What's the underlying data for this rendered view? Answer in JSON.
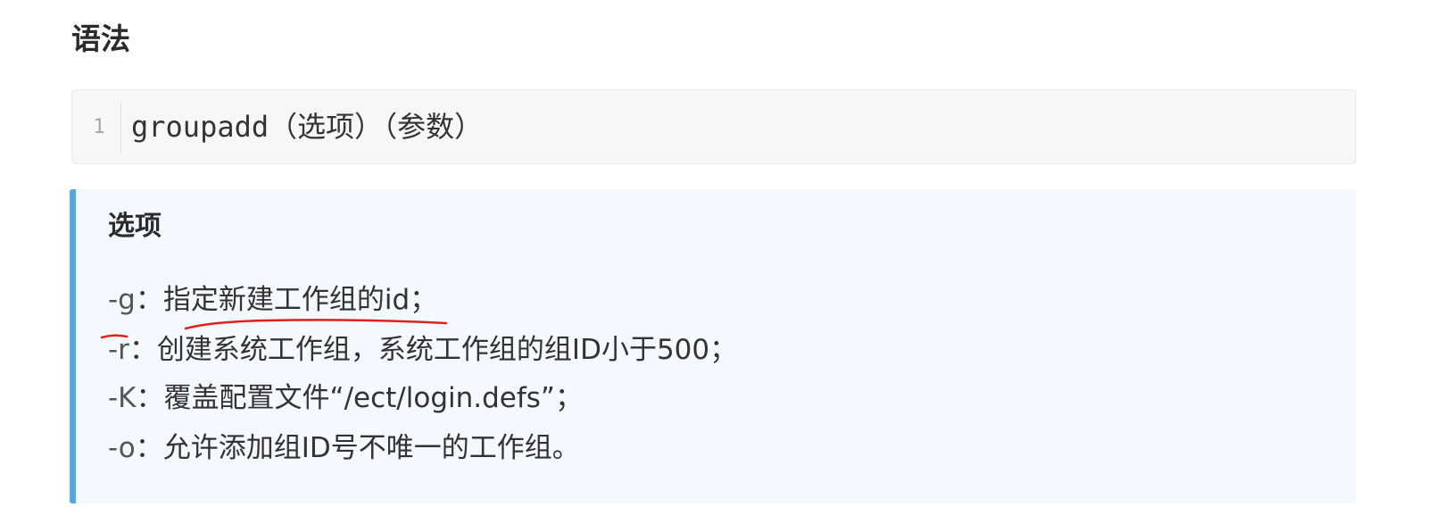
{
  "syntax": {
    "heading": "语法",
    "line_number": "1",
    "code": "groupadd（选项）（参数）"
  },
  "options": {
    "title": "选项",
    "items": [
      {
        "flag": "-g",
        "text": "：指定新建工作组的id；"
      },
      {
        "flag": "-r",
        "text": "：创建系统工作组，系统工作组的组ID小于500；"
      },
      {
        "flag": "-K",
        "text": "：覆盖配置文件“/ect/login.defs”；"
      },
      {
        "flag": "-o",
        "text": "：允许添加组ID号不唯一的工作组。"
      }
    ]
  },
  "colors": {
    "callout_border": "#5aa6e0",
    "callout_bg": "#f3f9fe",
    "code_bg": "#f7f7f7",
    "annotation": "#e02020"
  }
}
